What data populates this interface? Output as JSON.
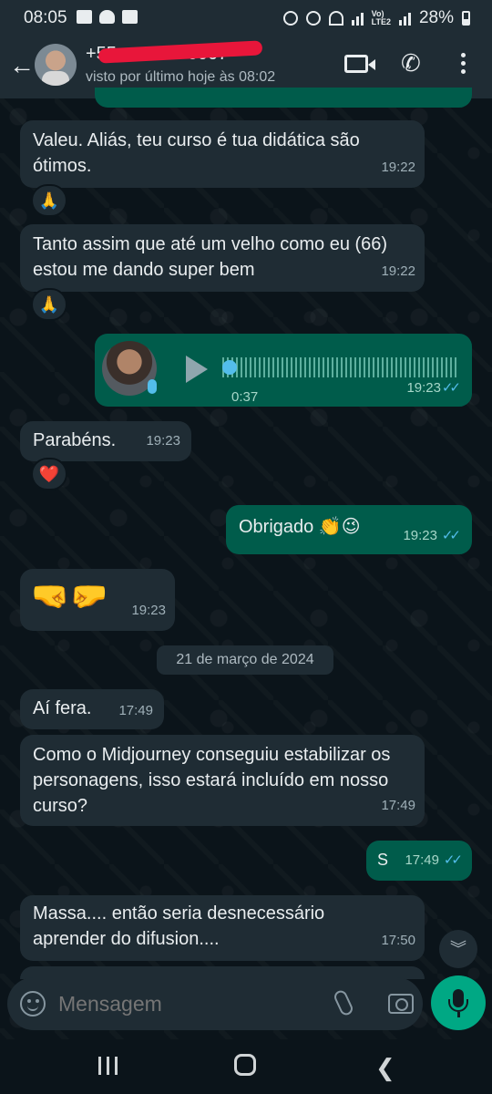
{
  "status_bar": {
    "time": "08:05",
    "volte": "Vo)\nLTE2",
    "battery": "28%"
  },
  "header": {
    "contact_name": "+55 ... 0700 0007",
    "last_seen": "visto por último hoje às 08:02"
  },
  "messages": [
    {
      "dir": "in",
      "text": "Valeu. Aliás, teu curso é tua didática são ótimos.",
      "time": "19:22",
      "reaction": "🙏"
    },
    {
      "dir": "in",
      "text": "Tanto assim que até um velho como eu (66) estou me dando super bem",
      "time": "19:22",
      "reaction": "🙏"
    },
    {
      "dir": "out",
      "type": "voice",
      "duration": "0:37",
      "time": "19:23",
      "read": "✓✓"
    },
    {
      "dir": "in",
      "text": "Parabéns.",
      "time": "19:23",
      "reaction": "❤️"
    },
    {
      "dir": "out",
      "text": "Obrigado 👏😉",
      "time": "19:23",
      "read": "✓✓"
    },
    {
      "dir": "in",
      "text": "🤜🤛",
      "time": "19:23"
    },
    {
      "dir": "in",
      "text": "Aí fera.",
      "time": "17:49"
    },
    {
      "dir": "in",
      "text": "Como o Midjourney conseguiu estabilizar os personagens, isso estará incluído em nosso curso?",
      "time": "17:49"
    },
    {
      "dir": "out",
      "text": "S",
      "time": "17:49",
      "read": "✓✓"
    },
    {
      "dir": "in",
      "text": "Massa.... então seria desnecessário aprender do difusion....",
      "time": "17:50"
    }
  ],
  "date_separator": "21 de março de 2024",
  "composer": {
    "placeholder": "Mensagem"
  },
  "icons": {
    "back": "arrow-left-icon",
    "video": "video-camera-icon",
    "call": "phone-icon",
    "menu": "more-vert-icon",
    "emoji": "emoji-icon",
    "attach": "paperclip-icon",
    "camera": "camera-icon",
    "mic": "mic-icon",
    "scroll": "double-chevron-down-icon"
  },
  "colors": {
    "background": "#0b141a",
    "incoming_bubble": "#1f2c34",
    "outgoing_bubble": "#005c4b",
    "accent": "#00a884",
    "read_ticks": "#53bdeb"
  }
}
